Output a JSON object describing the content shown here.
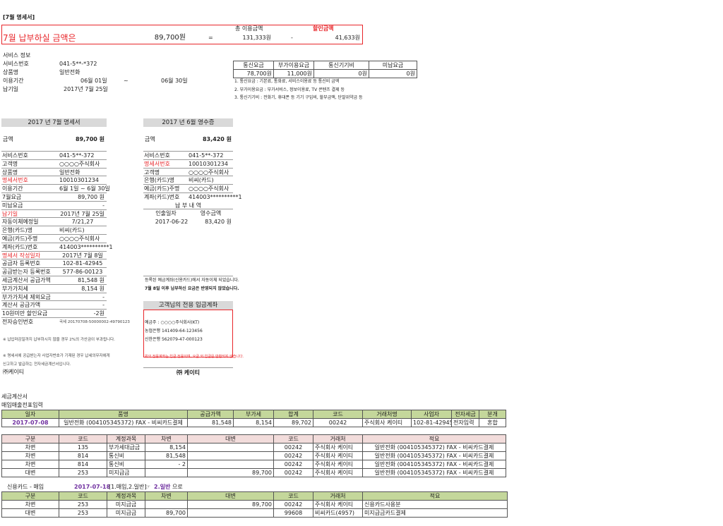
{
  "title": "[7월 명세서]",
  "summary": {
    "total_label": "총 이용금액",
    "discount_label": "할인금액",
    "pay_label": "7월 납부하실 금액은",
    "pay_amount": "89,700원",
    "eq": "=",
    "total": "131,333원",
    "minus": "-",
    "discount": "41,633원"
  },
  "service": {
    "title": "서비스 정보",
    "rows": [
      {
        "label": "서비스번호",
        "value": "041-5**-*372"
      },
      {
        "label": "상품명",
        "value": "일반전화"
      },
      {
        "label": "이용기간",
        "from": "06월 01일",
        "tilde": "~",
        "to": "06월 30일"
      },
      {
        "label": "납기일",
        "value": "2017년 7월 25일"
      }
    ]
  },
  "fees": {
    "headers": [
      "통신요금",
      "부가이용요금",
      "통신기기비",
      "미납요금"
    ],
    "values": [
      "78,700원",
      "11,000원",
      "0원",
      "0원"
    ],
    "notes": [
      "1. 통신요금 : 기본료, 통화료, 서비스이용료 등 통신비 금액",
      "2. 부가이용요금 : 부가서비스, 정보이용료, TV 콘텐츠 결제 등",
      "3. 통신기기비 : 전화기, 휴대폰 등 기기 구입비, 할부금액, 단말위약금 등"
    ]
  },
  "bill": {
    "header": "2017 년 7월 명세서",
    "amount_label": "금액",
    "amount": "89,700 원",
    "rows": [
      {
        "label": "서비스번호",
        "value": "041-5**-372",
        "al": "l"
      },
      {
        "label": "고객명",
        "value": "○○○○주식회사",
        "al": "l"
      },
      {
        "label": "상품명",
        "value": "일반전화",
        "al": "l"
      },
      {
        "label": "명세서번호",
        "value": "10010301234",
        "al": "l",
        "red": true
      },
      {
        "label": "이용기간",
        "value": "6월 1일 ~ 6월 30일",
        "al": "l"
      },
      {
        "label": "7월요금",
        "value": "89,700 원",
        "al": "r"
      },
      {
        "label": "미납요금",
        "value": "-",
        "al": "r"
      },
      {
        "label": "납기일",
        "value": "2017년 7월 25일",
        "al": "r",
        "red": true
      },
      {
        "label": "자동이체예정일",
        "value": "7/21,27",
        "al": "c"
      },
      {
        "label": "은행(카드)명",
        "value": "비씨(카드)",
        "al": "l"
      },
      {
        "label": "예금(카드)주명",
        "value": "○○○○주식회사",
        "al": "l"
      },
      {
        "label": "계좌(카드)번호",
        "value": "414003**********1",
        "al": "l"
      },
      {
        "label": "명세서 작성일자",
        "value": "2017년 7월 8일",
        "al": "c",
        "red": true
      },
      {
        "label": "공급자 등록번호",
        "value": "102-81-42945",
        "al": "c"
      },
      {
        "label": "공급받는자 등록번호",
        "value": "577-86-00123",
        "al": "c"
      },
      {
        "label": "세금계산서 공급가액",
        "value": "81,548 원",
        "al": "r"
      },
      {
        "label": "부가가치세",
        "value": "8,154 원",
        "al": "r"
      },
      {
        "label": "부가가치세 제외요금",
        "value": "-",
        "al": "r"
      },
      {
        "label": "계산서 공급가액",
        "value": "-",
        "al": "r"
      },
      {
        "label": "10원미만 할인요금",
        "value": "-2원",
        "al": "r"
      },
      {
        "label": "전자승인번호",
        "value": "국세 20170708-50000002-49790123",
        "al": "tiny"
      }
    ],
    "notes": [
      "※ 납입마감일까지 납부하시지 않을 경우 2%의 가산금이 부과됩니다.",
      "※ 명세서에 공급받는자 사업자번호가 기재된 경우 납세의무자에게",
      "신고하고 발급하는 전자세금계산서입니다."
    ],
    "company": "㈜케이티"
  },
  "receipt": {
    "header": "2017 년 6월 영수증",
    "amount_label": "금액",
    "amount": "83,420 원",
    "rows": [
      {
        "label": "서비스번호",
        "value": "041-5**-372"
      },
      {
        "label": "명세서번호",
        "value": "10010301234",
        "red": true
      },
      {
        "label": "고객명",
        "value": "○○○○주식회사"
      },
      {
        "label": "은행(카드)명",
        "value": "비씨(카드)"
      },
      {
        "label": "예금(카드)주명",
        "value": "○○○○주식회사"
      },
      {
        "label": "계좌(카드)번호",
        "value": "414003**********1"
      }
    ],
    "paid_title": "납 부 내 역",
    "paid_headers": [
      "인출일자",
      "영수금액"
    ],
    "paid_values": [
      "2017-06-22",
      "83,420 원"
    ],
    "notes": [
      "등록된 예금계좌(신용카드)에서 자동이체 되었습니다.",
      "7월 8일 이후 납부하신 요금은 반영되지 않았습니다."
    ],
    "account_title": "고객님의 전용 입금계좌",
    "account_lines": [
      "예금주 : ○○○○주식회사(KT)",
      "농협은행 141409-64-123456",
      "신한은행 562079-47-000123"
    ],
    "account_note": "위의 전용계좌는 입금 전용이며, 요금 외 입금은 반환되지 않습니다.",
    "company": "㈜ 케이티"
  },
  "tax": {
    "title": "세금계산서",
    "subtitle": "매입매출전표입력",
    "t1_headers": [
      "일자",
      "품명",
      "공급가액",
      "부가세",
      "합계",
      "코드",
      "거래처명",
      "사업자",
      "전자세금",
      "분개"
    ],
    "t1_row": [
      "2017-07-08",
      "일반전화 (004105345372) FAX - 비씨카드결제",
      "81,548",
      "8,154",
      "89,702",
      "00242",
      "주식회사 케이티",
      "102-81-42945",
      "전자입력",
      "혼합"
    ],
    "t2_headers": [
      "구분",
      "코드",
      "계정과목",
      "차변",
      "대변",
      "코드",
      "거래처",
      "적요"
    ],
    "t2_rows": [
      [
        "차변",
        "135",
        "부가세대급금",
        "8,154",
        "",
        "00242",
        "주식회사 케이티",
        "일반전화 (004105345372) FAX - 비씨카드결제"
      ],
      [
        "차변",
        "814",
        "통신비",
        "81,548",
        "",
        "00242",
        "주식회사 케이티",
        "일반전화 (004105345372) FAX - 비씨카드결제"
      ],
      [
        "차변",
        "814",
        "통신비",
        "-        2",
        "",
        "00242",
        "주식회사 케이티",
        "일반전화 (004105345372) FAX - 비씨카드결제"
      ],
      [
        "대변",
        "253",
        "미지급금",
        "",
        "89,700",
        "00242",
        "주식회사 케이티",
        "일반전화 (004105345372) FAX - 비씨카드결제"
      ]
    ]
  },
  "card": {
    "label": "신용카드 - 매입",
    "date": "2017-07-18",
    "option": "[1.매입,2.일반]",
    "arrow": "☞",
    "choice": "2.일반",
    "suffix": "으로",
    "headers": [
      "구분",
      "코드",
      "계정과목",
      "차변",
      "대변",
      "코드",
      "거래처",
      "적요"
    ],
    "rows": [
      [
        "차변",
        "253",
        "미지급금",
        "",
        "89,700",
        "00242",
        "주식회사 케이티",
        "신용카드사용분"
      ],
      [
        "대변",
        "253",
        "미지급금",
        "89,700",
        "",
        "99608",
        "비씨카드(4957)",
        "미지급금카드결제"
      ]
    ]
  }
}
